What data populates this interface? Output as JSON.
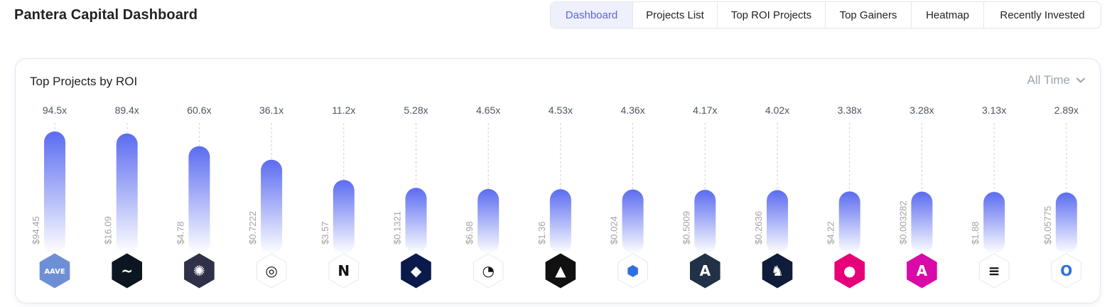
{
  "header": {
    "title": "Pantera Capital Dashboard",
    "tabs": [
      {
        "label": "Dashboard",
        "active": true
      },
      {
        "label": "Projects List",
        "active": false
      },
      {
        "label": "Top ROI Projects",
        "active": false
      },
      {
        "label": "Top Gainers",
        "active": false
      },
      {
        "label": "Heatmap",
        "active": false
      },
      {
        "label": "Recently Invested",
        "active": false
      }
    ]
  },
  "card": {
    "title": "Top Projects by ROI",
    "range": "All Time"
  },
  "colors": {
    "bar_top": "#5b6cf0",
    "bar_bottom": "#ffffff",
    "active_tab_text": "#5a67d8"
  },
  "chart_data": {
    "type": "bar",
    "title": "Top Projects by ROI",
    "grid": false,
    "values": [
      94.5,
      89.4,
      60.6,
      36.1,
      11.2,
      5.28,
      4.65,
      4.53,
      4.36,
      4.17,
      4.02,
      3.38,
      3.28,
      3.13,
      2.89
    ],
    "value_labels": [
      "94.5x",
      "89.4x",
      "60.6x",
      "36.1x",
      "11.2x",
      "5.28x",
      "4.65x",
      "4.53x",
      "4.36x",
      "4.17x",
      "4.02x",
      "3.38x",
      "3.28x",
      "3.13x",
      "2.89x"
    ],
    "price_labels": [
      "$94.45",
      "$16.09",
      "$4.78",
      "$0.7222",
      "$3.57",
      "$0.1321",
      "$6.98",
      "$1.36",
      "$0.024",
      "$0.5009",
      "$0.2636",
      "$4.22",
      "$0.003282",
      "$1.88",
      "$0.05775"
    ],
    "icons": [
      {
        "name": "aave-icon",
        "bg": "#6c8fd6",
        "glyph": "AAVE"
      },
      {
        "name": "injective-icon",
        "bg": "#0b1620",
        "glyph": "~"
      },
      {
        "name": "cosmos-icon",
        "bg": "#2e3148",
        "glyph": "✺"
      },
      {
        "name": "sui-wave-icon",
        "bg": "#ffffff",
        "glyph": "◎"
      },
      {
        "name": "near-icon",
        "bg": "#ffffff",
        "glyph": "N"
      },
      {
        "name": "crystal-icon",
        "bg": "#0a1a4a",
        "glyph": "◆"
      },
      {
        "name": "ring-icon",
        "bg": "#ffffff",
        "glyph": "◔"
      },
      {
        "name": "triangle-icon",
        "bg": "#111111",
        "glyph": "▲"
      },
      {
        "name": "ankr-icon",
        "bg": "#ffffff",
        "glyph": "⬢"
      },
      {
        "name": "arbitrum-icon",
        "bg": "#213147",
        "glyph": "A"
      },
      {
        "name": "1inch-icon",
        "bg": "#0f1d3a",
        "glyph": "♞"
      },
      {
        "name": "polkadot-icon",
        "bg": "#e6007a",
        "glyph": "●"
      },
      {
        "name": "amp-icon",
        "bg": "#d80ba6",
        "glyph": "A"
      },
      {
        "name": "stack-icon",
        "bg": "#ffffff",
        "glyph": "≡"
      },
      {
        "name": "oasis-icon",
        "bg": "#ffffff",
        "glyph": "O"
      }
    ]
  }
}
